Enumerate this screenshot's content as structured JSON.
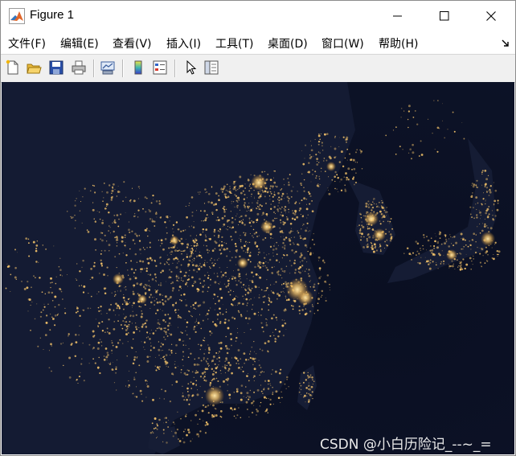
{
  "window": {
    "title": "Figure 1",
    "controls": {
      "minimize": "minimize-icon",
      "maximize": "maximize-icon",
      "close": "close-icon"
    }
  },
  "menu": {
    "items": [
      {
        "label": "文件(F)"
      },
      {
        "label": "编辑(E)"
      },
      {
        "label": "查看(V)"
      },
      {
        "label": "插入(I)"
      },
      {
        "label": "工具(T)"
      },
      {
        "label": "桌面(D)"
      },
      {
        "label": "窗口(W)"
      },
      {
        "label": "帮助(H)"
      }
    ]
  },
  "toolbar": {
    "buttons": [
      {
        "icon": "new-figure-icon"
      },
      {
        "icon": "open-file-icon"
      },
      {
        "icon": "save-icon"
      },
      {
        "icon": "print-icon"
      },
      {
        "icon": "link-plot-icon"
      },
      {
        "icon": "insert-colorbar-icon"
      },
      {
        "icon": "insert-legend-icon"
      },
      {
        "icon": "edit-plot-icon"
      },
      {
        "icon": "property-inspector-icon"
      }
    ]
  },
  "figure": {
    "image_subject": "night-lights-satellite-image-east-asia",
    "background_color": "#0c1226",
    "light_color": "#f5c46a"
  },
  "watermark": "CSDN @小白历险记_--~_="
}
